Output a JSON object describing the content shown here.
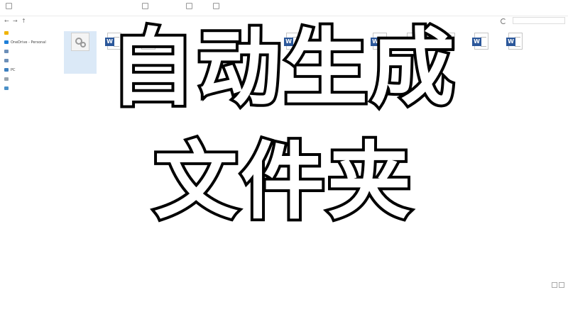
{
  "ribbon": {
    "items": [
      {
        "label": "",
        "icon": "folder-icon"
      },
      {
        "label": "",
        "icon": "new-item-icon"
      },
      {
        "label": "",
        "icon": "open-icon"
      },
      {
        "label": "",
        "icon": "select-icon"
      }
    ]
  },
  "address": {
    "breadcrumbs": [
      "",
      "",
      "",
      ""
    ],
    "search_placeholder": ""
  },
  "nav": {
    "items": [
      {
        "label": "",
        "icon": "star-icon"
      },
      {
        "label": "OneDrive - Personal",
        "icon": "cloud-icon"
      },
      {
        "label": "",
        "icon": "library-icon"
      },
      {
        "label": "",
        "icon": "library-icon"
      },
      {
        "label": "PC",
        "icon": "pc-icon"
      },
      {
        "label": "",
        "icon": "drive-icon"
      },
      {
        "label": "",
        "icon": "network-icon"
      }
    ]
  },
  "files": [
    {
      "label": "",
      "type": "exe",
      "selected": true
    },
    {
      "label": "",
      "type": "word",
      "selected": false
    },
    {
      "label": "",
      "type": "word",
      "selected": false
    },
    {
      "label": "",
      "type": "word",
      "selected": false
    },
    {
      "label": "",
      "type": "word",
      "selected": false
    },
    {
      "label": "",
      "type": "word",
      "selected": false
    },
    {
      "label": "",
      "type": "word",
      "selected": false
    },
    {
      "label": "",
      "type": "word",
      "selected": false
    },
    {
      "label": "",
      "type": "word",
      "selected": false
    }
  ],
  "status": {
    "text": ""
  },
  "overlay": {
    "line1": "自动生成",
    "line2": "文件夹"
  },
  "colors": {
    "word_badge": "#2b579a",
    "selection": "#dbe9f7",
    "overlay_fill": "#ffffff",
    "overlay_stroke": "#000000"
  }
}
